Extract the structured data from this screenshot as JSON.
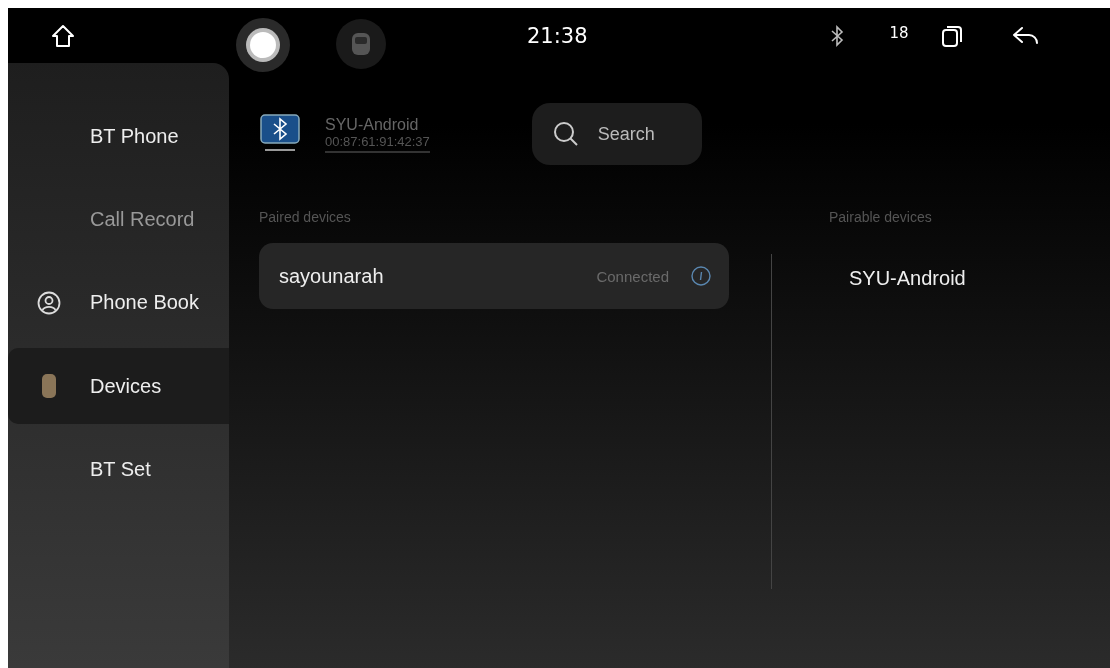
{
  "status_bar": {
    "time": "21:38",
    "badge": "18"
  },
  "sidebar": {
    "items": [
      {
        "label": "BT Phone",
        "kind": "plain",
        "selected": false,
        "disabled": false
      },
      {
        "label": "Call Record",
        "kind": "plain",
        "selected": false,
        "disabled": true
      },
      {
        "label": "Phone Book",
        "kind": "contacts",
        "selected": false,
        "disabled": false
      },
      {
        "label": "Devices",
        "kind": "devices",
        "selected": true,
        "disabled": false
      },
      {
        "label": "BT Set",
        "kind": "plain",
        "selected": false,
        "disabled": false
      }
    ]
  },
  "local_device": {
    "name": "SYU-Android",
    "address": "00:87:61:91:42:37"
  },
  "search": {
    "label": "Search"
  },
  "paired": {
    "heading": "Paired devices",
    "devices": [
      {
        "name": "sayounarah",
        "status": "Connected"
      }
    ]
  },
  "pairable": {
    "heading": "Pairable devices",
    "devices": [
      {
        "name": "SYU-Android"
      }
    ]
  }
}
